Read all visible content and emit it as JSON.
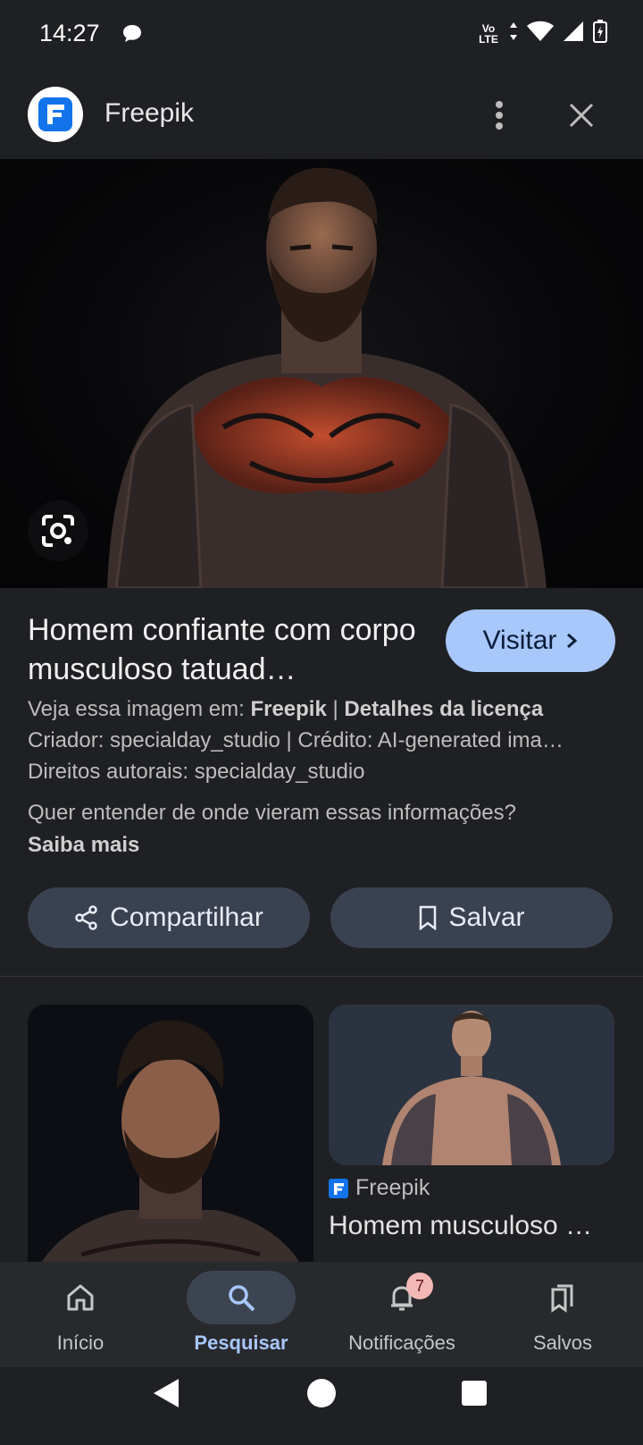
{
  "status_bar": {
    "time": "14:27",
    "network_label": "Vo LTE"
  },
  "header": {
    "site_name": "Freepik"
  },
  "result": {
    "title": "Homem confiante com corpo musculoso tatuad…",
    "visit_label": "Visitar",
    "source_prefix": "Veja essa imagem em:",
    "source_name": "Freepik",
    "source_sep": "|",
    "license_link": "Detalhes da licença",
    "creator_line": "Criador: specialday_studio | Crédito: AI-generated ima…",
    "copyright_line": "Direitos autorais: specialday_studio",
    "about_text": "Quer entender de onde vieram essas informações?",
    "about_link": "Saiba mais"
  },
  "actions": {
    "share_label": "Compartilhar",
    "save_label": "Salvar"
  },
  "related": {
    "card2_source": "Freepik",
    "card2_title": "Homem musculoso …"
  },
  "bottom_nav": {
    "items": [
      {
        "label": "Início",
        "icon": "home-icon"
      },
      {
        "label": "Pesquisar",
        "icon": "search-icon",
        "active": true
      },
      {
        "label": "Notificações",
        "icon": "bell-icon",
        "badge": "7"
      },
      {
        "label": "Salvos",
        "icon": "bookmarks-icon"
      }
    ]
  },
  "colors": {
    "background": "#1f2023",
    "accent": "#a8c7fa",
    "button": "#3a4150",
    "nav_bg": "#28292d",
    "badge": "#f2b8b5"
  }
}
